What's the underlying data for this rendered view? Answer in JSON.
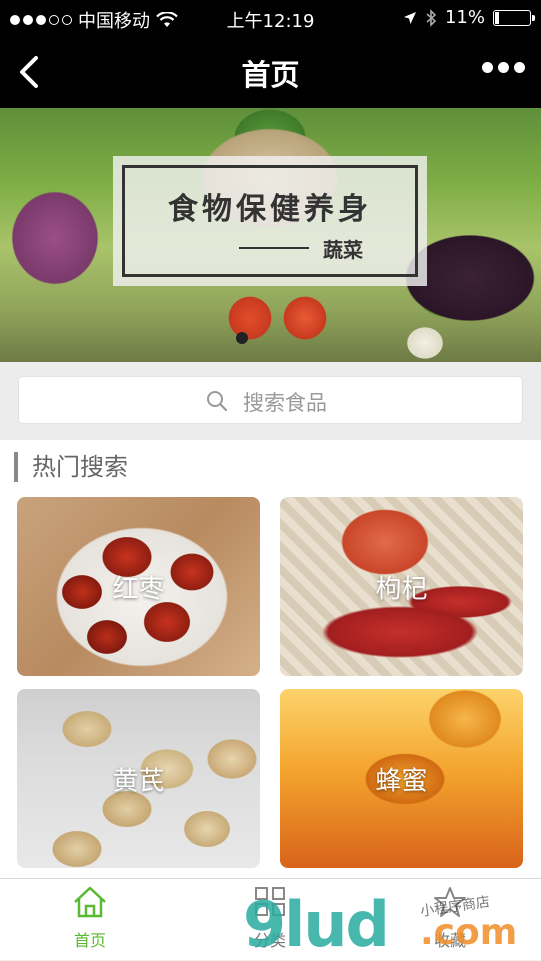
{
  "status_bar": {
    "carrier": "中国移动",
    "time": "上午12:19",
    "battery_text": "11%",
    "battery_level": 0.11
  },
  "nav": {
    "title": "首页"
  },
  "banner": {
    "title": "食物保健养身",
    "subtitle": "蔬菜",
    "slide_index": 1
  },
  "search": {
    "placeholder": "搜索食品"
  },
  "hot": {
    "heading": "热门搜索",
    "items": [
      {
        "label": "红枣"
      },
      {
        "label": "枸杞"
      },
      {
        "label": "黄芪"
      },
      {
        "label": "蜂蜜"
      }
    ]
  },
  "tabbar": {
    "tabs": [
      {
        "label": "首页",
        "active": true
      },
      {
        "label": "分类",
        "active": false
      },
      {
        "label": "收藏",
        "active": false
      }
    ]
  },
  "watermark": {
    "main": "9lud",
    "suffix": ".com",
    "small": "小程序商店"
  },
  "colors": {
    "accent": "#5bb832",
    "nav_bg": "#000000"
  }
}
